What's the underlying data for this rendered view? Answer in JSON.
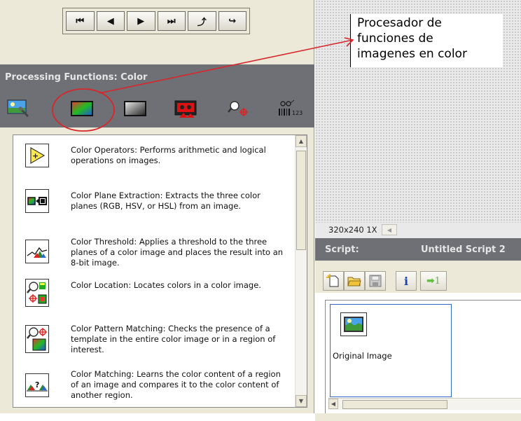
{
  "nav": {
    "buttons": [
      "⏮",
      "◀",
      "▶",
      "⏭",
      "⤴",
      "↪"
    ]
  },
  "processing": {
    "title": "Processing Functions: Color",
    "tools": [
      "image-tools-icon",
      "color-functions-icon",
      "grayscale-functions-icon",
      "binary-functions-icon",
      "machine-vision-icon",
      "identification-icon"
    ],
    "identification_label": "123"
  },
  "functions": [
    {
      "icon": "color-operators-icon",
      "text": "Color Operators:  Performs arithmetic and logical operations on images."
    },
    {
      "icon": "color-plane-extraction-icon",
      "text": "Color Plane Extraction:  Extracts the three color planes (RGB, HSV, or HSL) from an image."
    },
    {
      "icon": "color-threshold-icon",
      "text": "Color Threshold:  Applies a threshold to the three planes of a color image and places the result into an 8-bit image."
    },
    {
      "icon": "color-location-icon",
      "text": "Color Location:  Locates colors in a color image."
    },
    {
      "icon": "color-pattern-matching-icon",
      "text": "Color Pattern Matching:  Checks the presence of a template in the entire color image or in a region of interest."
    },
    {
      "icon": "color-matching-icon",
      "text": "Color Matching:  Learns the color content of a region of an image and compares it to the color content of another region."
    }
  ],
  "image_info": "320x240 1X",
  "script": {
    "label": "Script:",
    "name": "Untitled Script 2",
    "tools": [
      "new-script-icon",
      "open-script-icon",
      "save-script-icon",
      "info-icon",
      "run-once-icon"
    ],
    "run_label": "1",
    "steps": [
      {
        "label": "Original Image"
      }
    ]
  },
  "annotation": {
    "lines": [
      "Procesador de",
      "funciones de",
      "imagenes en color"
    ]
  },
  "colors": {
    "panel_bg": "#ece9d8",
    "header_bg": "#6e7075",
    "header_text": "#e6e6e6",
    "annotation_red": "#d9262b",
    "selection_blue": "#316ac5"
  }
}
